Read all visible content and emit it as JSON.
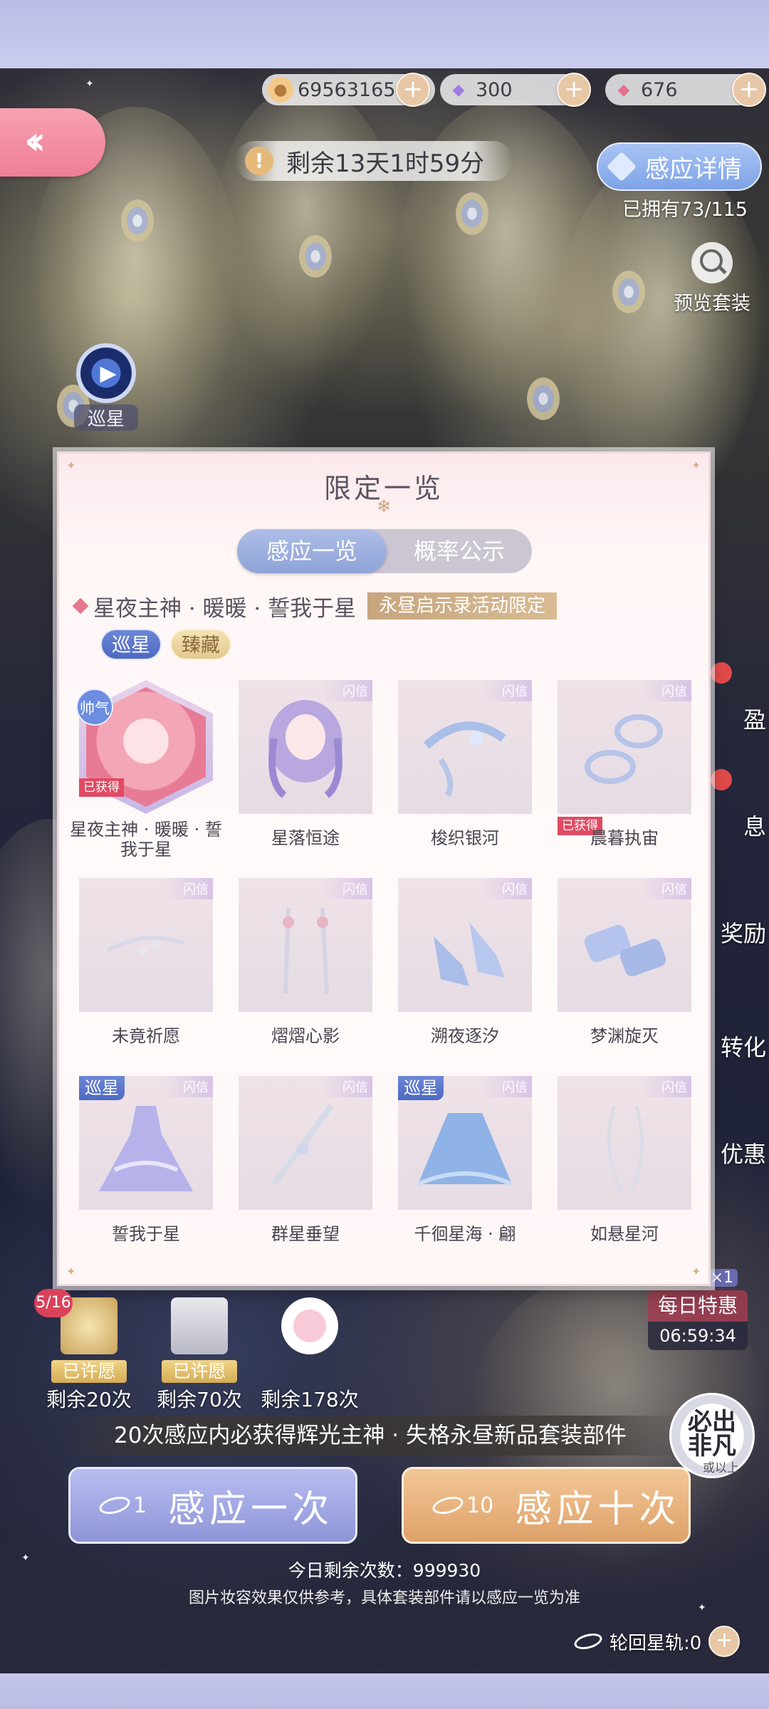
{
  "currency": {
    "coins": "69563165",
    "diamonds": "300",
    "pink_diamonds": "676"
  },
  "timer": {
    "text": "剩余13天1时59分"
  },
  "detail_button": {
    "label": "感应详情"
  },
  "owned": "已拥有73/115",
  "preview_label": "预览套装",
  "patrol_side_label": "巡星",
  "modal": {
    "title": "限定一览",
    "tabs": [
      "感应一览",
      "概率公示"
    ],
    "suit_name": "星夜主神 · 暖暖 · 誓我于星",
    "event_tag": "永昼启示录活动限定",
    "chips": [
      "巡星",
      "臻藏"
    ],
    "items": [
      {
        "name": "星夜主神 · 暖暖 · 誓我于星",
        "obtained": "已获得",
        "tag": "帅气"
      },
      {
        "name": "星落恒途"
      },
      {
        "name": "梭织银河"
      },
      {
        "name": "晨暮执宙",
        "obtained": "已获得"
      },
      {
        "name": "未竟祈愿"
      },
      {
        "name": "熠熠心影"
      },
      {
        "name": "溯夜逐汐"
      },
      {
        "name": "梦渊旋灭"
      },
      {
        "name": "誓我于星",
        "patrol": "巡星"
      },
      {
        "name": "群星垂望"
      },
      {
        "name": "千徊星海 · 翩",
        "patrol": "巡星"
      },
      {
        "name": "如悬星河"
      }
    ]
  },
  "side_menu": [
    "盈",
    "息",
    "奖励",
    "转化",
    "优惠"
  ],
  "daily_deal": {
    "badge": "×1",
    "title": "每日特惠",
    "countdown": "06:59:34"
  },
  "wishes": [
    {
      "count": "5/16",
      "status": "已许愿",
      "remaining": "剩余20次"
    },
    {
      "status": "已许愿",
      "remaining": "剩余70次"
    },
    {
      "remaining": "剩余178次"
    }
  ],
  "guarantee_text": "20次感应内必获得辉光主神 · 失格永昼新品套装部件",
  "rare_badge": {
    "line1": "必出",
    "line1b": "非凡",
    "line2": "或以上"
  },
  "draw_one": {
    "cost": "1",
    "label": "感应一次"
  },
  "draw_ten": {
    "cost": "10",
    "label": "感应十次"
  },
  "today_remaining": "今日剩余次数：999930",
  "disclaimer": "图片妆容效果仅供参考，具体套装部件请以感应一览为准",
  "star_orbit": "轮回星轨:0"
}
